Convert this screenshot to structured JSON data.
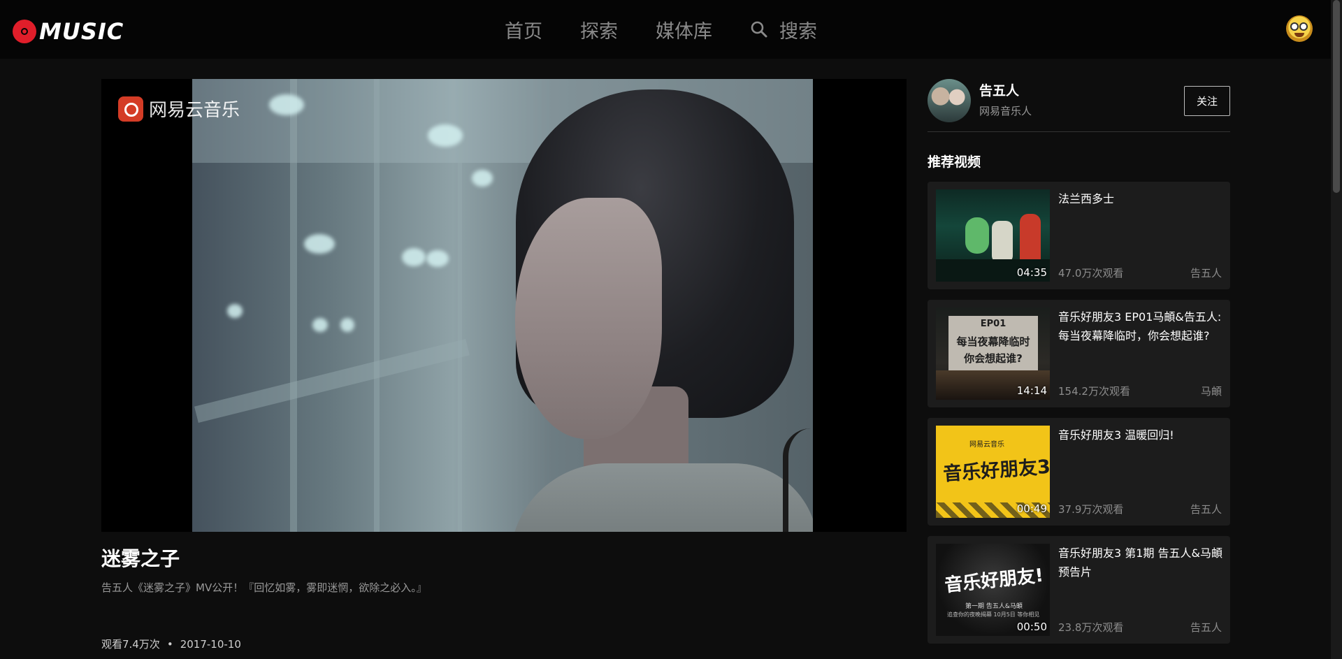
{
  "header": {
    "logo_text": "MUSIC",
    "nav": [
      "首页",
      "探索",
      "媒体库"
    ],
    "search_label": "搜索"
  },
  "player": {
    "watermark": "网易云音乐"
  },
  "video": {
    "title": "迷雾之子",
    "description": "告五人《迷雾之子》MV公开！『回忆如雾，雾即迷惘，欲除之必入。』",
    "views": "观看7.4万次",
    "separator": "•",
    "date": "2017-10-10"
  },
  "artist": {
    "name": "告五人",
    "subtitle": "网易音乐人",
    "follow_label": "关注"
  },
  "recommend": {
    "heading": "推荐视频",
    "items": [
      {
        "title": "法兰西多士",
        "duration": "04:35",
        "views": "47.0万次观看",
        "author": "告五人"
      },
      {
        "title": "音乐好朋友3 EP01马頔&告五人: 每当夜幕降临时，你会想起谁?",
        "duration": "14:14",
        "views": "154.2万次观看",
        "author": "马頔",
        "thumb_text": [
          "EP01",
          "每当夜幕降临时",
          "你会想起谁?"
        ]
      },
      {
        "title": "音乐好朋友3 温暖回归!",
        "duration": "00:49",
        "views": "37.9万次观看",
        "author": "告五人",
        "thumb_text": [
          "网易云音乐",
          "音乐好朋友3"
        ]
      },
      {
        "title": "音乐好朋友3 第1期 告五人&马頔 预告片",
        "duration": "00:50",
        "views": "23.8万次观看",
        "author": "告五人",
        "thumb_text": [
          "音乐好朋友!",
          "第一期 告五人&马頔",
          "追查你的夜晚揭幕 10月5日 等你相见"
        ]
      }
    ]
  },
  "colors": {
    "background": "#0d0d0d",
    "header": "#050505",
    "card": "#1c1c1c",
    "brand_red": "#e01e2a"
  }
}
